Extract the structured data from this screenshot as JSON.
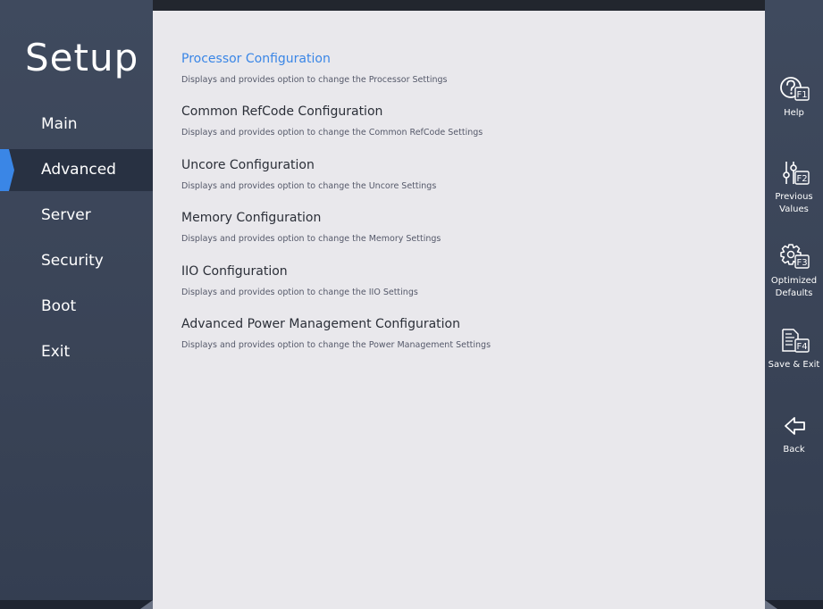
{
  "sidebar": {
    "title": "Setup",
    "items": [
      {
        "label": "Main",
        "active": false
      },
      {
        "label": "Advanced",
        "active": true
      },
      {
        "label": "Server",
        "active": false
      },
      {
        "label": "Security",
        "active": false
      },
      {
        "label": "Boot",
        "active": false
      },
      {
        "label": "Exit",
        "active": false
      }
    ]
  },
  "main": {
    "entries": [
      {
        "title": "Processor Configuration",
        "description": "Displays and provides option to change the Processor Settings",
        "selected": true
      },
      {
        "title": "Common RefCode Configuration",
        "description": "Displays and provides option to change the Common RefCode Settings",
        "selected": false
      },
      {
        "title": "Uncore Configuration",
        "description": "Displays and provides option to change the Uncore Settings",
        "selected": false
      },
      {
        "title": "Memory Configuration",
        "description": "Displays and provides option to change the Memory Settings",
        "selected": false
      },
      {
        "title": "IIO Configuration",
        "description": "Displays and provides option to change the IIO Settings",
        "selected": false
      },
      {
        "title": "Advanced Power Management Configuration",
        "description": "Displays and provides option to change the Power Management Settings",
        "selected": false
      }
    ]
  },
  "toolbar": {
    "help": {
      "label": "Help",
      "key": "F1",
      "icon": "help-icon"
    },
    "previous_values": {
      "label": "Previous\nValues",
      "key": "F2",
      "icon": "sliders-icon"
    },
    "optimized_defaults": {
      "label": "Optimized\nDefaults",
      "key": "F3",
      "icon": "gear-icon"
    },
    "save_exit": {
      "label": "Save & Exit",
      "key": "F4",
      "icon": "save-document-icon"
    },
    "back": {
      "label": "Back",
      "icon": "back-arrow-icon"
    }
  },
  "colors": {
    "accent": "#3a86e6",
    "sidebar_bg": "#3a4457",
    "active_item_bg": "#283142",
    "content_bg": "#e9e8ec"
  }
}
